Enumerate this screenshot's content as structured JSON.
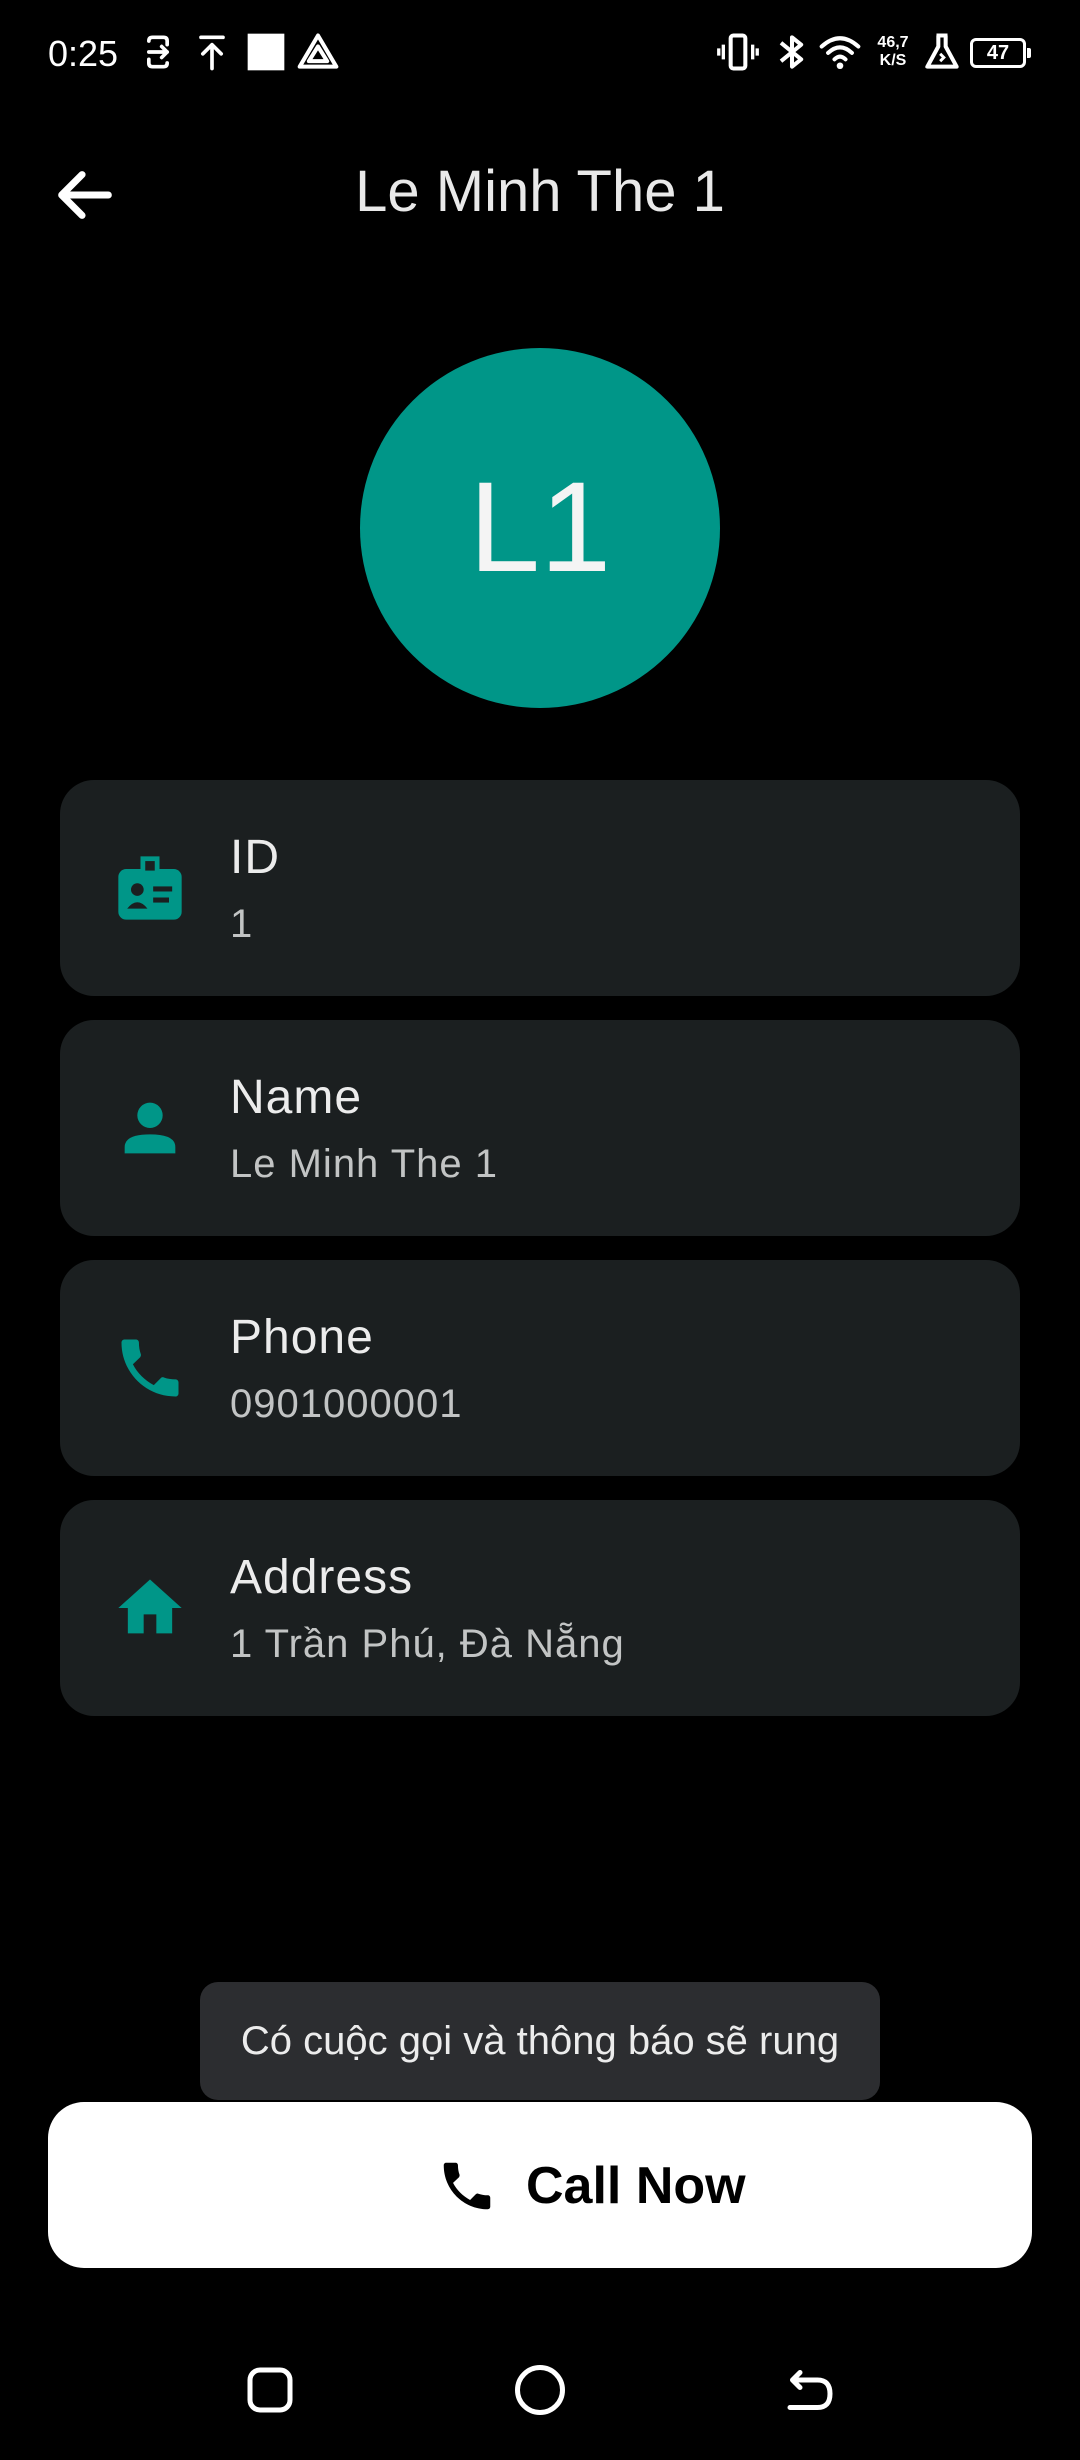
{
  "status_bar": {
    "time": "0:25",
    "network_speed_value": "46,7",
    "network_speed_unit": "K/S",
    "battery_level": "47",
    "icons": [
      "sync-icon",
      "upload-icon",
      "square-notification-icon",
      "navigation-triangle-icon",
      "vibrate-icon",
      "bluetooth-icon",
      "wifi-icon",
      "flask-icon",
      "battery-icon"
    ]
  },
  "header": {
    "title": "Le Minh The 1",
    "back_icon": "arrow-left-icon"
  },
  "avatar": {
    "initials": "L1",
    "color": "#009688"
  },
  "details": [
    {
      "icon": "id-badge-icon",
      "label": "ID",
      "value": "1"
    },
    {
      "icon": "person-icon",
      "label": "Name",
      "value": "Le Minh The 1"
    },
    {
      "icon": "phone-icon",
      "label": "Phone",
      "value": "0901000001"
    },
    {
      "icon": "home-icon",
      "label": "Address",
      "value": "1 Trần Phú, Đà Nẵng"
    }
  ],
  "toast": {
    "message": "Có cuộc gọi và thông báo sẽ rung"
  },
  "call_button": {
    "label": "Call Now",
    "icon": "phone-icon"
  },
  "navigation_bar": {
    "buttons": [
      "recents-icon",
      "home-circle-icon",
      "back-nav-icon"
    ]
  },
  "colors": {
    "background": "#000000",
    "card_background": "#1b1f20",
    "accent": "#009688",
    "toast_background": "#2c2d30",
    "button_background": "#ffffff"
  }
}
